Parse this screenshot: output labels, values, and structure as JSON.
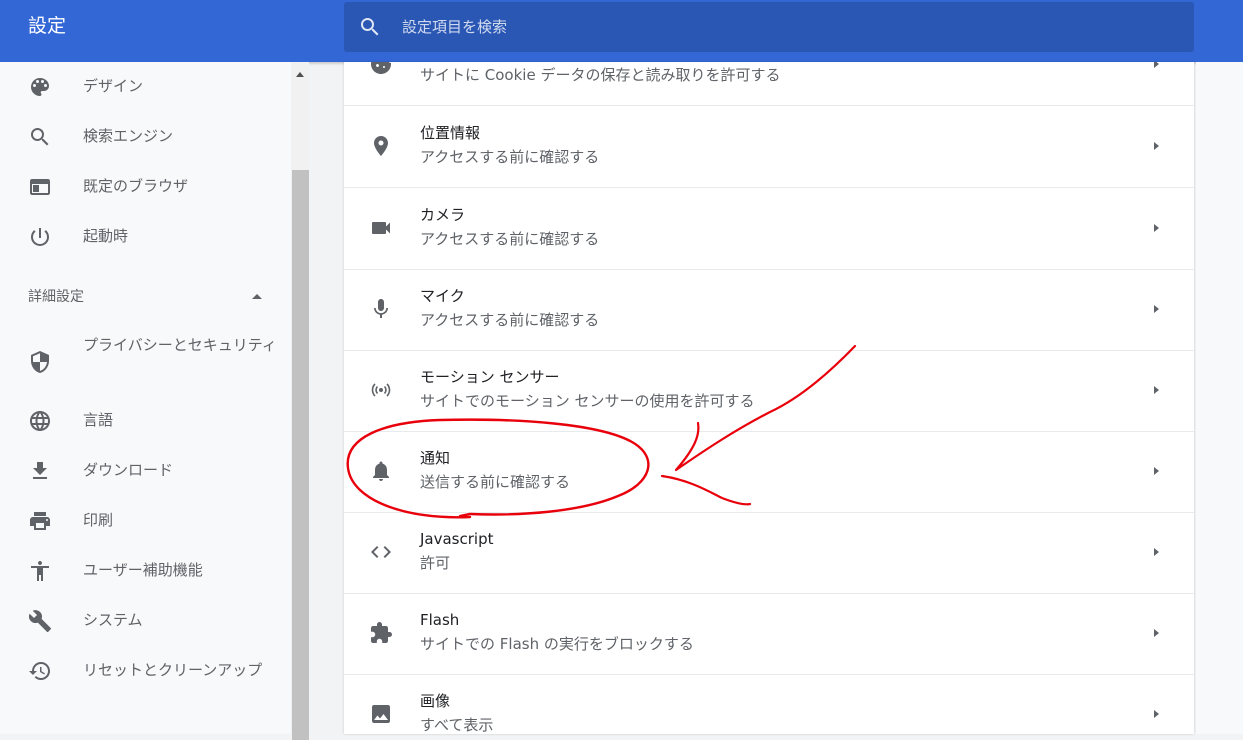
{
  "header": {
    "title": "設定",
    "search_placeholder": "設定項目を検索"
  },
  "sidebar": {
    "items_top": [
      {
        "label": "デザイン",
        "icon": "palette-icon"
      },
      {
        "label": "検索エンジン",
        "icon": "search-icon"
      },
      {
        "label": "既定のブラウザ",
        "icon": "browser-window-icon"
      },
      {
        "label": "起動時",
        "icon": "power-icon"
      }
    ],
    "advanced_header": "詳細設定",
    "items_advanced": [
      {
        "label": "プライバシーとセキュリティ",
        "icon": "shield-icon"
      },
      {
        "label": "言語",
        "icon": "globe-icon"
      },
      {
        "label": "ダウンロード",
        "icon": "download-icon"
      },
      {
        "label": "印刷",
        "icon": "printer-icon"
      },
      {
        "label": "ユーザー補助機能",
        "icon": "accessibility-icon"
      },
      {
        "label": "システム",
        "icon": "wrench-icon"
      },
      {
        "label": "リセットとクリーンアップ",
        "icon": "restore-icon"
      }
    ]
  },
  "content": {
    "rows": [
      {
        "title": "",
        "subtitle": "サイトに Cookie データの保存と読み取りを許可する",
        "icon": "cookie-icon"
      },
      {
        "title": "位置情報",
        "subtitle": "アクセスする前に確認する",
        "icon": "location-pin-icon"
      },
      {
        "title": "カメラ",
        "subtitle": "アクセスする前に確認する",
        "icon": "camera-icon"
      },
      {
        "title": "マイク",
        "subtitle": "アクセスする前に確認する",
        "icon": "microphone-icon"
      },
      {
        "title": "モーション センサー",
        "subtitle": "サイトでのモーション センサーの使用を許可する",
        "icon": "motion-sensor-icon"
      },
      {
        "title": "通知",
        "subtitle": "送信する前に確認する",
        "icon": "bell-icon"
      },
      {
        "title": "Javascript",
        "subtitle": "許可",
        "icon": "code-icon"
      },
      {
        "title": "Flash",
        "subtitle": "サイトでの Flash の実行をブロックする",
        "icon": "puzzle-icon"
      },
      {
        "title": "画像",
        "subtitle": "すべて表示",
        "icon": "image-icon"
      }
    ]
  },
  "colors": {
    "header": "#3367d6",
    "search": "#2a56b4",
    "annotation": "#e8000b",
    "icon": "#5f6368"
  }
}
